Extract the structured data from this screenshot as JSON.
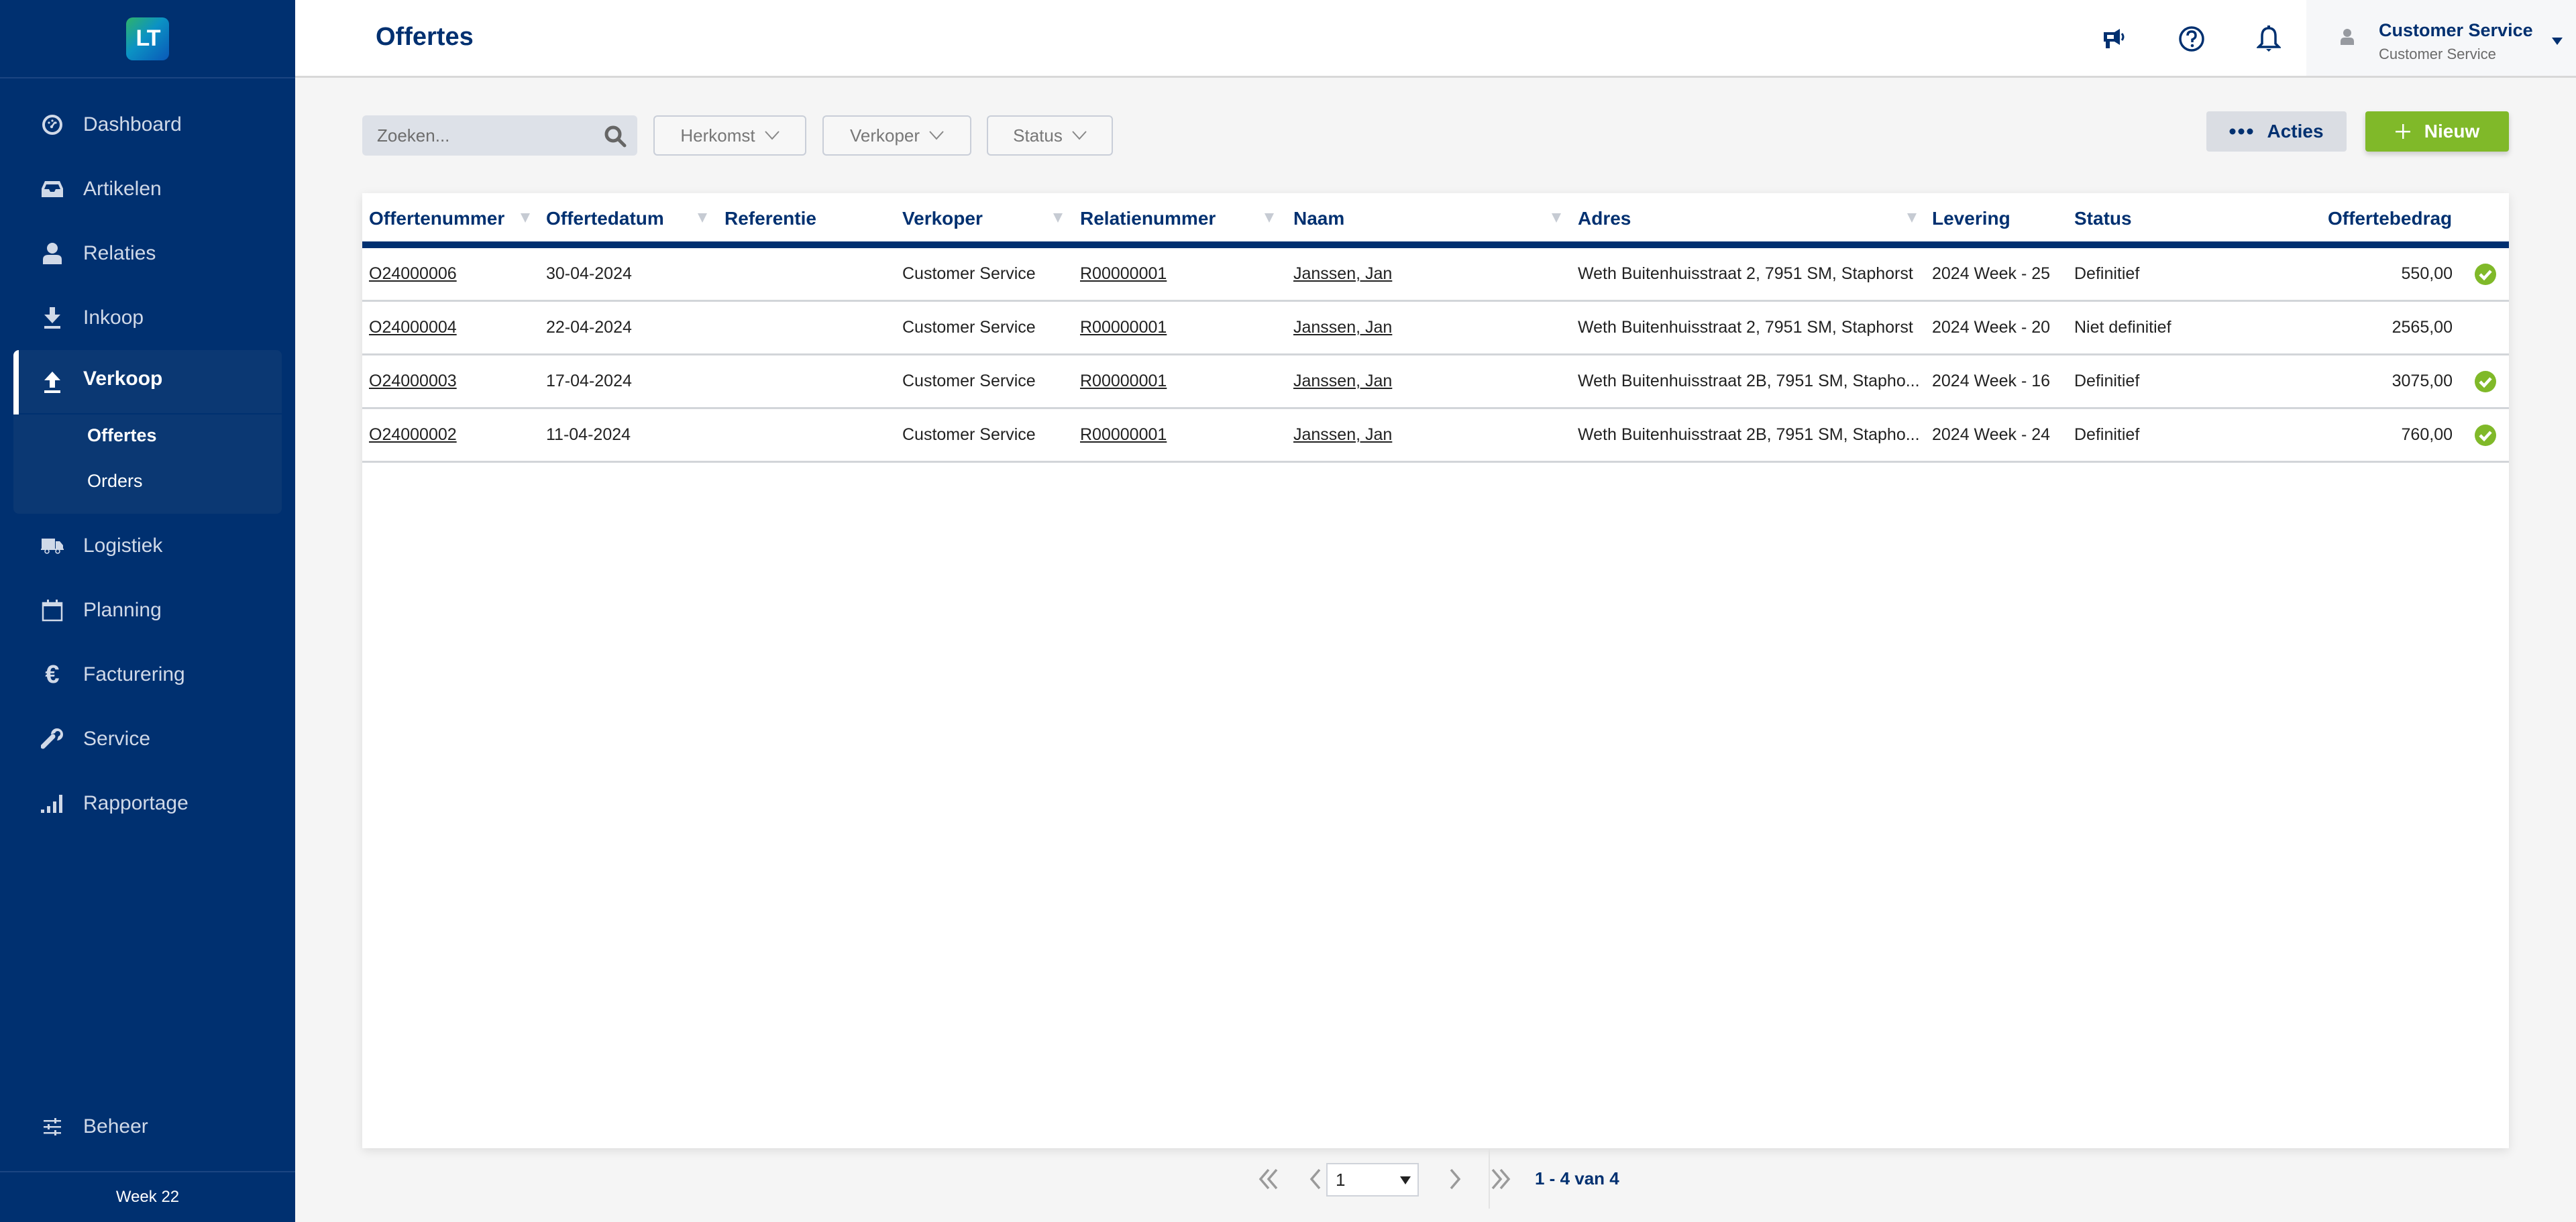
{
  "app": {
    "logo_text": "LT",
    "colors": {
      "brand_navy": "#003070",
      "accent_green": "#80b929",
      "sidebar_bg": "#003070"
    }
  },
  "sidebar": {
    "items": [
      {
        "label": "Dashboard",
        "icon": "dashboard-gauge-icon"
      },
      {
        "label": "Artikelen",
        "icon": "inbox-tray-icon"
      },
      {
        "label": "Relaties",
        "icon": "user-icon"
      },
      {
        "label": "Inkoop",
        "icon": "download-arrow-icon"
      },
      {
        "label": "Verkoop",
        "icon": "upload-arrow-icon",
        "active": true,
        "children": [
          {
            "label": "Offertes",
            "active": true
          },
          {
            "label": "Orders"
          }
        ]
      },
      {
        "label": "Logistiek",
        "icon": "truck-icon"
      },
      {
        "label": "Planning",
        "icon": "calendar-icon"
      },
      {
        "label": "Facturering",
        "icon": "euro-icon"
      },
      {
        "label": "Service",
        "icon": "wrench-icon"
      },
      {
        "label": "Rapportage",
        "icon": "signal-bars-icon"
      }
    ],
    "bottom_item": {
      "label": "Beheer",
      "icon": "sliders-icon"
    },
    "footer": "Week 22"
  },
  "header": {
    "title": "Offertes",
    "icons": [
      "megaphone-icon",
      "help-circle-icon",
      "bell-icon"
    ],
    "user": {
      "name": "Customer Service",
      "role": "Customer Service"
    }
  },
  "toolbar": {
    "search_placeholder": "Zoeken...",
    "search_value": "",
    "filters": [
      "Herkomst",
      "Verkoper",
      "Status"
    ],
    "acties_label": "Acties",
    "nieuw_label": "Nieuw"
  },
  "table": {
    "columns": [
      "Offertenummer",
      "Offertedatum",
      "Referentie",
      "Verkoper",
      "Relatienummer",
      "Naam",
      "Adres",
      "Levering",
      "Status",
      "Offertebedrag"
    ],
    "rows": [
      {
        "offertenummer": "O24000006",
        "offertedatum": "30-04-2024",
        "referentie": "",
        "verkoper": "Customer  Service",
        "relatienummer": "R00000001",
        "naam": "Janssen, Jan",
        "adres": "Weth Buitenhuisstraat 2, 7951 SM, Staphorst",
        "levering": "2024 Week - 25",
        "status": "Definitief",
        "bedrag": "550,00",
        "approved": true
      },
      {
        "offertenummer": "O24000004",
        "offertedatum": "22-04-2024",
        "referentie": "",
        "verkoper": "Customer  Service",
        "relatienummer": "R00000001",
        "naam": "Janssen, Jan",
        "adres": "Weth Buitenhuisstraat 2, 7951 SM, Staphorst",
        "levering": "2024 Week - 20",
        "status": "Niet definitief",
        "bedrag": "2565,00",
        "approved": false
      },
      {
        "offertenummer": "O24000003",
        "offertedatum": "17-04-2024",
        "referentie": "",
        "verkoper": "Customer  Service",
        "relatienummer": "R00000001",
        "naam": "Janssen, Jan",
        "adres": "Weth Buitenhuisstraat 2B, 7951 SM, Stapho...",
        "levering": "2024 Week - 16",
        "status": "Definitief",
        "bedrag": "3075,00",
        "approved": true
      },
      {
        "offertenummer": "O24000002",
        "offertedatum": "11-04-2024",
        "referentie": "",
        "verkoper": "Customer  Service",
        "relatienummer": "R00000001",
        "naam": "Janssen, Jan",
        "adres": "Weth Buitenhuisstraat 2B, 7951 SM, Stapho...",
        "levering": "2024 Week - 24",
        "status": "Definitief",
        "bedrag": "760,00",
        "approved": true
      }
    ]
  },
  "pagination": {
    "current_page": "1",
    "info": "1 - 4 van 4"
  }
}
